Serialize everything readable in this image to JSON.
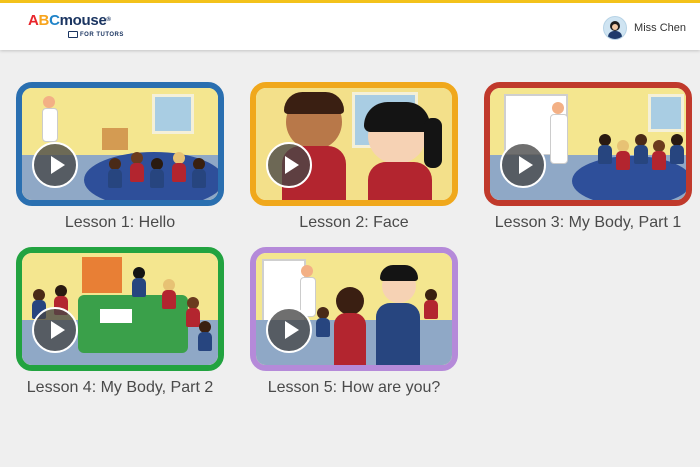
{
  "header": {
    "logo": {
      "text_abc": "ABC",
      "text_mouse": "mouse",
      "tm": "®",
      "sub": "FOR TUTORS"
    },
    "user": {
      "name": "Miss Chen"
    }
  },
  "lessons": [
    {
      "title": "Lesson 1: Hello",
      "border_color": "#2a6fb0"
    },
    {
      "title": "Lesson 2: Face",
      "border_color": "#f0a81c"
    },
    {
      "title": "Lesson 3: My Body, Part 1",
      "border_color": "#c0392b"
    },
    {
      "title": "Lesson 4: My Body, Part 2",
      "border_color": "#22a340"
    },
    {
      "title": "Lesson 5: How are you?",
      "border_color": "#b58ad9"
    }
  ],
  "icons": {
    "play": "play-icon",
    "avatar": "user-avatar"
  }
}
